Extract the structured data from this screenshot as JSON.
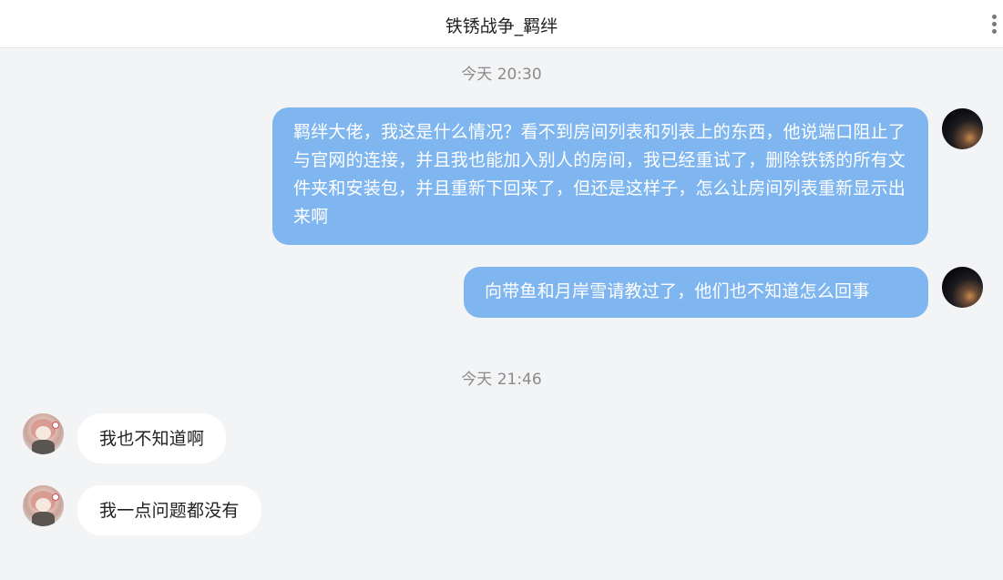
{
  "header": {
    "title": "铁锈战争_羁绊"
  },
  "messages": [
    {
      "timestamp": "今天 20:30",
      "items": [
        {
          "from": "self",
          "text": "羁绊大佬，我这是什么情况？看不到房间列表和列表上的东西，他说端口阻止了与官网的连接，并且我也能加入别人的房间，我已经重试了，删除铁锈的所有文件夹和安装包，并且重新下回来了，但还是这样子，怎么让房间列表重新显示出来啊"
        },
        {
          "from": "self",
          "text": "向带鱼和月岸雪请教过了，他们也不知道怎么回事"
        }
      ]
    },
    {
      "timestamp": "今天 21:46",
      "items": [
        {
          "from": "other",
          "text": "我也不知道啊"
        },
        {
          "from": "other",
          "text": "我一点问题都没有"
        }
      ]
    }
  ],
  "colors": {
    "outgoing_bubble": "#7fb6f0",
    "incoming_bubble": "#ffffff",
    "background": "#f3f4f6"
  },
  "icons": {
    "menu": "more-vertical-icon"
  }
}
